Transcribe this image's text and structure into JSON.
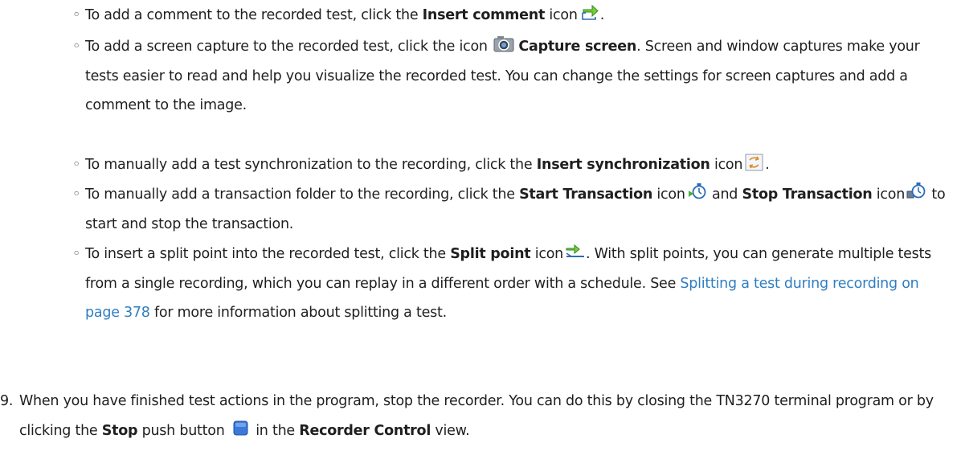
{
  "bullet_marker": "◦",
  "bullets": [
    {
      "p1": "To add a comment to the recorded test, click the ",
      "b1": "Insert comment",
      "p2": " icon",
      "p3": "."
    },
    {
      "p1": "To add a screen capture to the recorded test, click the icon ",
      "b1": "Capture screen",
      "p2": ". Screen and window captures make your tests easier to read and help you visualize the recorded test. You can change the settings for screen captures and add a comment to the image."
    },
    {
      "p1": "To manually add a test synchronization to the recording, click the ",
      "b1": "Insert synchronization",
      "p2": " icon",
      "p3": "."
    },
    {
      "p1": "To manually add a transaction folder to the recording, click the ",
      "b1": "Start Transaction",
      "p2": " icon",
      "p3": " and ",
      "b2": "Stop Transaction",
      "p4": " icon",
      "p5": " to start and stop the transaction."
    },
    {
      "p1": "To insert a split point into the recorded test, click the ",
      "b1": "Split point",
      "p2": " icon",
      "p3": ". With split points, you can generate multiple tests from a single recording, which you can replay in a different order with a schedule. See ",
      "link": "Splitting a test during recording on page 378",
      "p4": " for more information about splitting a test."
    }
  ],
  "step9": {
    "num": "9.",
    "p1": "When you have finished test actions in the program, stop the recorder. You can do this by closing the TN3270 terminal program or by clicking the ",
    "b1": "Stop",
    "p2": "  push button ",
    "p3": " in the ",
    "b2": "Recorder Control",
    "p4": " view."
  },
  "icons": {
    "insert_comment": "insert-comment-icon",
    "capture_screen": "camera-icon",
    "insert_sync": "synchronization-icon",
    "start_transaction": "start-transaction-icon",
    "stop_transaction": "stop-transaction-icon",
    "split_point": "split-point-icon",
    "stop_button": "stop-square-icon"
  },
  "colors": {
    "link": "#2f7ec1",
    "text": "#1f1f1f"
  }
}
